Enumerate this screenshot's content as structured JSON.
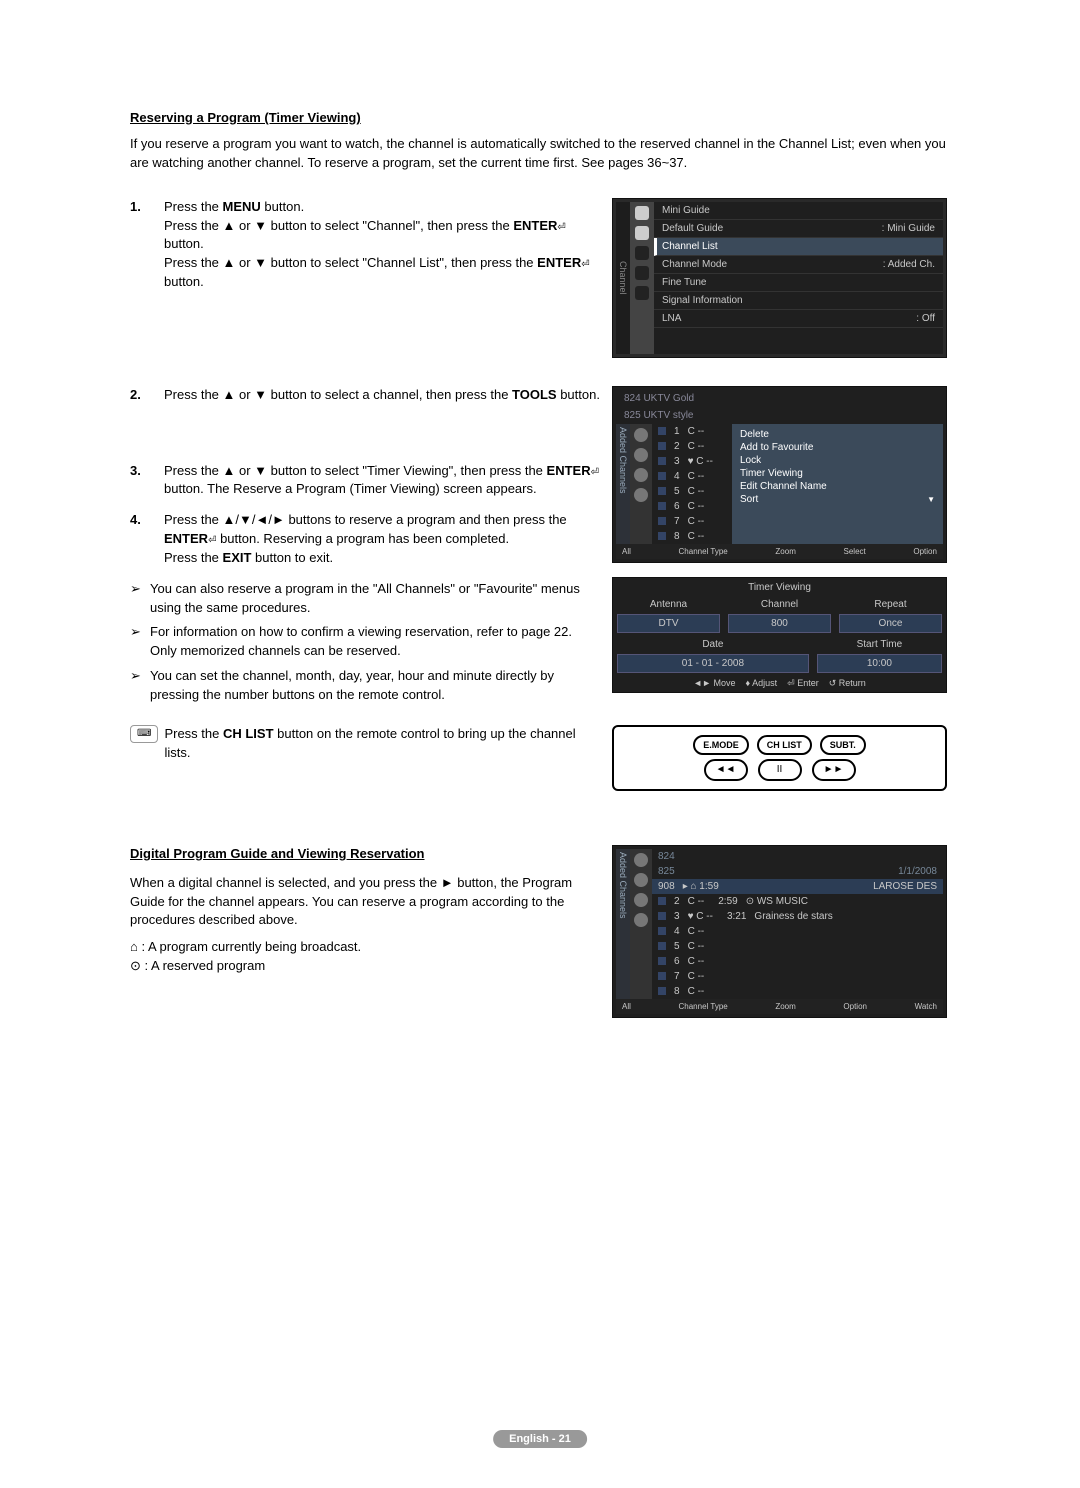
{
  "section1": {
    "title": "Reserving a Program (Timer Viewing)",
    "intro": "If you reserve a program you want to watch, the channel is automatically switched to the reserved channel in the Channel List; even when you are watching another channel. To reserve a program, set the current time first. See pages 36~37."
  },
  "steps": {
    "s1a": "Press the ",
    "s1a_bold": "MENU",
    "s1a_end": " button.",
    "s1b": "Press the ▲ or ▼ button to select \"Channel\", then press the ",
    "s1b_bold": "ENTER",
    "s1b_end": " button.",
    "s1c": "Press the ▲ or ▼ button to select \"Channel List\", then press the ",
    "s1c_bold": "ENTER",
    "s1c_end": " button.",
    "s2": "Press the ▲ or ▼ button to select a channel, then press the ",
    "s2_bold": "TOOLS",
    "s2_end": " button.",
    "s3a": "Press the ▲ or ▼ button to select \"Timer Viewing\", then press the ",
    "s3a_bold": "ENTER",
    "s3a_end": " button. The Reserve a Program (Timer Viewing) screen appears.",
    "s4a": "Press the ▲/▼/◄/► buttons to reserve a program and then press the ",
    "s4a_bold": "ENTER",
    "s4a_end": " button. Reserving a program has been completed.",
    "s4b": "Press the ",
    "s4b_bold": "EXIT",
    "s4b_end": " button to exit."
  },
  "notes": {
    "n1": "You can also reserve a program in the \"All Channels\" or \"Favourite\" menus using the same procedures.",
    "n2": "For information on how to confirm a viewing reservation, refer to page 22. Only memorized channels can be reserved.",
    "n3": "You can set the channel, month, day, year, hour and minute directly by pressing the number buttons on the remote control.",
    "chlist_a": "Press the ",
    "chlist_bold": "CH LIST",
    "chlist_b": " button on the remote control to bring up the channel lists."
  },
  "tv1": {
    "side": "Channel",
    "items": [
      [
        "Mini Guide",
        ""
      ],
      [
        "Default Guide",
        ": Mini Guide"
      ],
      [
        "Channel List",
        ""
      ],
      [
        "Channel Mode",
        ": Added Ch."
      ],
      [
        "Fine Tune",
        ""
      ],
      [
        "Signal Information",
        ""
      ],
      [
        "LNA",
        ": Off"
      ]
    ]
  },
  "tv2": {
    "side": "Added Channels",
    "head1": "824    UKTV Gold",
    "head2": "825    UKTV style",
    "rows": [
      [
        "1",
        "C --"
      ],
      [
        "2",
        "C --"
      ],
      [
        "3",
        "♥ C --"
      ],
      [
        "4",
        "C --"
      ],
      [
        "5",
        "C --"
      ],
      [
        "6",
        "C --"
      ],
      [
        "7",
        "C --"
      ],
      [
        "8",
        "C --"
      ]
    ],
    "popup": [
      "Delete",
      "Add to Favourite",
      "Lock",
      "Timer Viewing",
      "Edit Channel Name",
      "Sort"
    ],
    "foot": [
      "All",
      "Channel Type",
      "Zoom",
      "Select",
      "Option"
    ]
  },
  "tv3": {
    "title": "Timer Viewing",
    "labels": [
      "Antenna",
      "Channel",
      "Repeat"
    ],
    "vals": [
      "DTV",
      "800",
      "Once"
    ],
    "labels2": [
      "Date",
      "Start Time"
    ],
    "vals2": [
      "01 - 01 - 2008",
      "10:00"
    ],
    "foot": [
      "Move",
      "Adjust",
      "Enter",
      "Return"
    ]
  },
  "remote": {
    "btns": [
      "E.MODE",
      "CH LIST",
      "SUBT."
    ],
    "row2": [
      "◄◄",
      "II",
      "►►"
    ]
  },
  "section2": {
    "title": "Digital Program Guide and Viewing Reservation",
    "intro": "When a digital channel is selected, and you press the ► button, the Program Guide for the channel appears. You can reserve a program according to the procedures described above.",
    "leg1": " : A program currently being broadcast.",
    "leg2": " : A reserved program"
  },
  "tv4": {
    "side": "Added Channels",
    "head1": "824",
    "head2": "825",
    "date": "1/1/2008",
    "rows": [
      [
        "908",
        "▸ ⌂ 1:59",
        "LAROSE DES"
      ],
      [
        "2",
        "C --",
        "2:59",
        "⊙ WS MUSIC"
      ],
      [
        "3",
        "♥ C --",
        "3:21",
        "Grainess de stars"
      ],
      [
        "4",
        "C --",
        "",
        ""
      ],
      [
        "5",
        "C --",
        "",
        ""
      ],
      [
        "6",
        "C --",
        "",
        ""
      ],
      [
        "7",
        "C --",
        "",
        ""
      ],
      [
        "8",
        "C --",
        "",
        ""
      ]
    ],
    "foot": [
      "All",
      "Channel Type",
      "Zoom",
      "Option",
      "Watch"
    ]
  },
  "footer": "English - 21"
}
